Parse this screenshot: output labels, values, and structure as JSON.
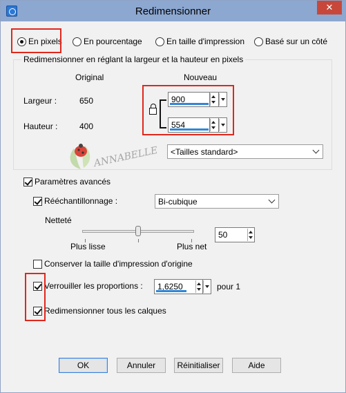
{
  "window": {
    "title": "Redimensionner",
    "close_label": "✕"
  },
  "mode": {
    "options": [
      "En pixels",
      "En pourcentage",
      "En taille d'impression",
      "Basé sur un côté"
    ],
    "selected_index": 0
  },
  "size_group": {
    "title": "Redimensionner en réglant la largeur et la hauteur en pixels",
    "col_original": "Original",
    "col_new": "Nouveau",
    "width_label": "Largeur :",
    "height_label": "Hauteur :",
    "width_original": "650",
    "height_original": "400",
    "width_new": "900",
    "height_new": "554",
    "standard_sizes": "<Tailles standard>"
  },
  "watermark": {
    "text": "ANNABELLE"
  },
  "advanced": {
    "label": "Paramètres avancés",
    "checked": true,
    "resample_label": "Rééchantillonnage :",
    "resample_checked": true,
    "resample_method": "Bi-cubique",
    "sharpness_label": "Netteté",
    "slider_left_label": "Plus lisse",
    "slider_right_label": "Plus net",
    "sharpness_value": "50",
    "sharpness_fraction": 0.5,
    "keep_print_label": "Conserver la taille d'impression d'origine",
    "keep_print_checked": false,
    "lock_ratio_label": "Verrouiller les proportions :",
    "lock_ratio_checked": true,
    "ratio_value": "1,6250",
    "ratio_suffix": "pour 1",
    "resize_layers_label": "Redimensionner tous les calques",
    "resize_layers_checked": true
  },
  "buttons": {
    "ok": "OK",
    "cancel": "Annuler",
    "reset": "Réinitialiser",
    "help": "Aide"
  },
  "colors": {
    "highlight": "#e0261c",
    "titlebar": "#8ca7d0",
    "close": "#c7483b",
    "value_underline": "#2f86d8"
  }
}
